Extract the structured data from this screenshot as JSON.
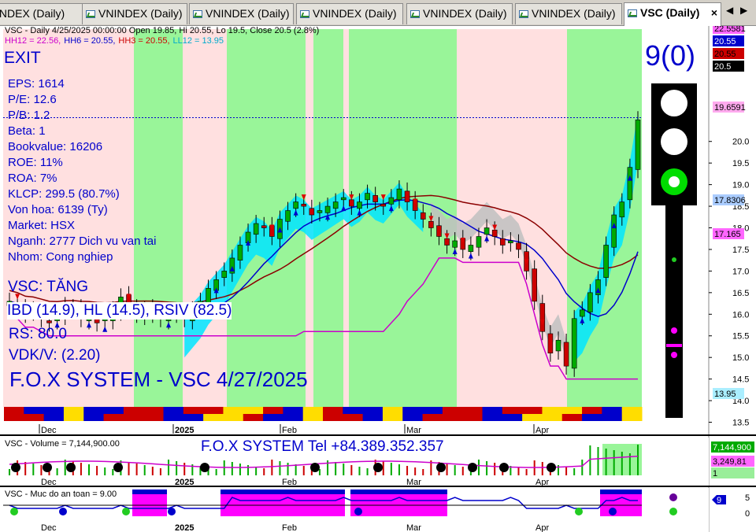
{
  "tabs": [
    {
      "label": "INDEX (Daily)",
      "active": false
    },
    {
      "label": "VNINDEX (Daily)",
      "active": false
    },
    {
      "label": "VNINDEX (Daily)",
      "active": false
    },
    {
      "label": "VNINDEX (Daily)",
      "active": false
    },
    {
      "label": "VNINDEX (Daily)",
      "active": false
    },
    {
      "label": "VNINDEX (Daily)",
      "active": false
    },
    {
      "label": "VSC (Daily)",
      "active": true
    }
  ],
  "tab_close": "×",
  "tab_nav": {
    "left": "◀",
    "right": "▶"
  },
  "price_panel": {
    "header": "VSC - Daily 4/25/2025 00:00:00 Open 19.85, Hi 20.55, Lo 19.5, Close 20.5 (2.8%)",
    "hh_line": [
      {
        "text": "HH12 = 22.56,",
        "color": "#cc00cc"
      },
      {
        "text": "HH6 = 20.55,",
        "color": "#0000cc"
      },
      {
        "text": "HH3 = 20.55,",
        "color": "#cc0000"
      },
      {
        "text": "LL12 = 13.95",
        "color": "#00aacc"
      }
    ],
    "exit_label": "EXIT",
    "signal_count": "9(0)",
    "fundamentals": [
      "EPS: 1614",
      "P/E: 12.6",
      "P/B: 1.2",
      "Beta: 1",
      "Bookvalue: 16206",
      "ROE: 11%",
      "ROA: 7%",
      "KLCP: 299.5 (80.7%)",
      "Von hoa: 6139 (Ty)",
      "Market: HSX",
      "Nganh: 2777 Dich vu van tai",
      "Nhom: Cong nghiep"
    ],
    "trend": "VSC: TĂNG",
    "ratings": "IBD (14.9), HL (14.5), RSIV (82.5)",
    "rs": "RS: 80.0",
    "vdk": "VDK/V:  (2.20)",
    "brand": "F.O.X SYSTEM - VSC 4/27/2025",
    "axis_ticks": [
      "20.0",
      "19.5",
      "19.0",
      "18.5",
      "18.0",
      "17.5",
      "17.0",
      "16.5",
      "16.0",
      "15.5",
      "15.0",
      "14.5",
      "14.0",
      "13.5"
    ],
    "axis_tags": [
      {
        "text": "22.5581",
        "bg": "#ff66ff",
        "fg": "#000000"
      },
      {
        "text": "20.55",
        "bg": "#0000cc",
        "fg": "#ffffff"
      },
      {
        "text": "20.55",
        "bg": "#cc0000",
        "fg": "#000000"
      },
      {
        "text": "20.5",
        "bg": "#000000",
        "fg": "#ffffff"
      },
      {
        "text": "19.6591",
        "bg": "#ffaaee",
        "fg": "#000000"
      },
      {
        "text": "17.8306",
        "bg": "#aaccff",
        "fg": "#000000"
      },
      {
        "text": "17.165",
        "bg": "#ff66ff",
        "fg": "#000000"
      },
      {
        "text": "13.95",
        "bg": "#aaeeff",
        "fg": "#000000"
      }
    ],
    "months": [
      "Dec",
      "2025",
      "Feb",
      "Mar",
      "Apr"
    ]
  },
  "volume_panel": {
    "header": "VSC - Volume = 7,144,900.00",
    "brand": "F.O.X SYSTEM Tel +84.389.352.357",
    "axis_tags": [
      {
        "text": "7,144,900",
        "bg": "#00aa00",
        "fg": "#ffffff"
      },
      {
        "text": "3,249,81",
        "bg": "#ff66ff",
        "fg": "#000000"
      },
      {
        "text": "1",
        "bg": "#99ee99",
        "fg": "#000000"
      }
    ]
  },
  "safety_panel": {
    "header": "VSC - Muc do an toan = 9.00",
    "axis_tags": [
      {
        "text": "9",
        "bg": "#0000cc",
        "fg": "#ffffff"
      }
    ],
    "axis_ticks": [
      "5",
      "0"
    ]
  },
  "colors": {
    "bull": "#00aa00",
    "bear": "#cc0000",
    "zone_green": "#99f599",
    "zone_pink": "#ffe0e0",
    "cloud_cyan": "#00e5ff",
    "cloud_gray": "#c0c0c0"
  },
  "chart_data": {
    "type": "candlestick",
    "symbol": "VSC",
    "timeframe": "Daily",
    "last_bar": {
      "date": "4/25/2025",
      "open": 19.85,
      "high": 20.55,
      "low": 19.5,
      "close": 20.5,
      "change_pct": 2.8
    },
    "ylim": [
      13.2,
      22.6
    ],
    "x_ticks": [
      "Dec",
      "2025",
      "Feb",
      "Mar",
      "Apr"
    ],
    "closes_approx": [
      16.3,
      16.2,
      16.0,
      16.1,
      15.9,
      15.8,
      16.0,
      16.2,
      16.1,
      15.9,
      16.0,
      15.8,
      15.9,
      16.1,
      16.4,
      16.2,
      16.0,
      16.1,
      16.0,
      15.9,
      16.0,
      16.0,
      15.9,
      16.1,
      16.3,
      16.6,
      16.8,
      17.0,
      17.3,
      17.6,
      17.9,
      18.1,
      18.0,
      17.8,
      18.2,
      18.4,
      18.6,
      18.5,
      18.3,
      18.4,
      18.5,
      18.6,
      18.7,
      18.5,
      18.6,
      18.8,
      18.6,
      18.5,
      18.7,
      18.9,
      18.6,
      18.4,
      18.2,
      18.0,
      17.8,
      17.6,
      17.7,
      17.5,
      17.6,
      17.8,
      18.0,
      17.8,
      17.6,
      17.7,
      17.5,
      17.0,
      16.3,
      15.6,
      15.1,
      15.4,
      14.8,
      15.9,
      16.1,
      16.5,
      16.8,
      17.6,
      18.3,
      18.6,
      19.4,
      20.5
    ],
    "volume_last": 7144900,
    "safety_level": 9
  }
}
